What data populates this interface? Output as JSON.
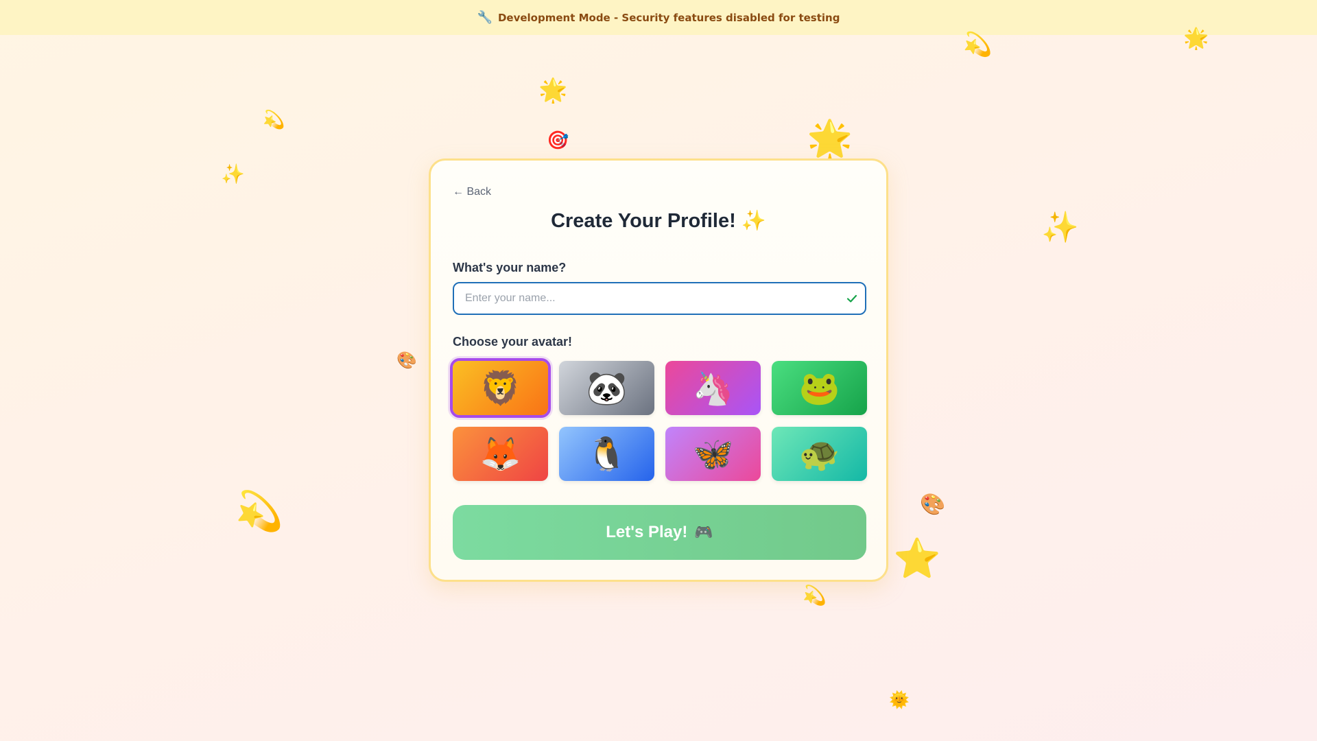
{
  "banner": {
    "icon": "wrench-icon",
    "text": "Development Mode - Security features disabled for testing",
    "wrench_glyph": "🔧"
  },
  "profile": {
    "back_label": "← Back",
    "title": "Create Your Profile!",
    "title_emoji": "✨",
    "name_label": "What's your name?",
    "name_value": "",
    "name_placeholder": "Enter your name...",
    "avatar_label": "Choose your avatar!",
    "selected_avatar": "lion",
    "avatars": [
      {
        "id": "lion",
        "glyph": "🦁",
        "colors": [
          "#fbbf24",
          "#f97316"
        ]
      },
      {
        "id": "panda",
        "glyph": "🐼",
        "colors": [
          "#d1d5db",
          "#6b7280"
        ]
      },
      {
        "id": "unicorn",
        "glyph": "🦄",
        "colors": [
          "#ec4899",
          "#a855f7"
        ]
      },
      {
        "id": "frog",
        "glyph": "🐸",
        "colors": [
          "#4ade80",
          "#16a34a"
        ]
      },
      {
        "id": "fox",
        "glyph": "🦊",
        "colors": [
          "#fb923c",
          "#ef4444"
        ]
      },
      {
        "id": "penguin",
        "glyph": "🐧",
        "colors": [
          "#93c5fd",
          "#2563eb"
        ]
      },
      {
        "id": "butterfly",
        "glyph": "🦋",
        "colors": [
          "#c084fc",
          "#ec4899"
        ]
      },
      {
        "id": "turtle",
        "glyph": "🐢",
        "colors": [
          "#6ee7b7",
          "#14b8a6"
        ]
      }
    ],
    "play_label": "Let's Play!",
    "play_emoji": "🎮"
  },
  "decorations": {
    "star": "⭐",
    "glowing_star": "🌟",
    "sparkles": "✨",
    "dizzy": "💫",
    "target": "🎯",
    "palette": "🎨",
    "sun": "🌞"
  }
}
